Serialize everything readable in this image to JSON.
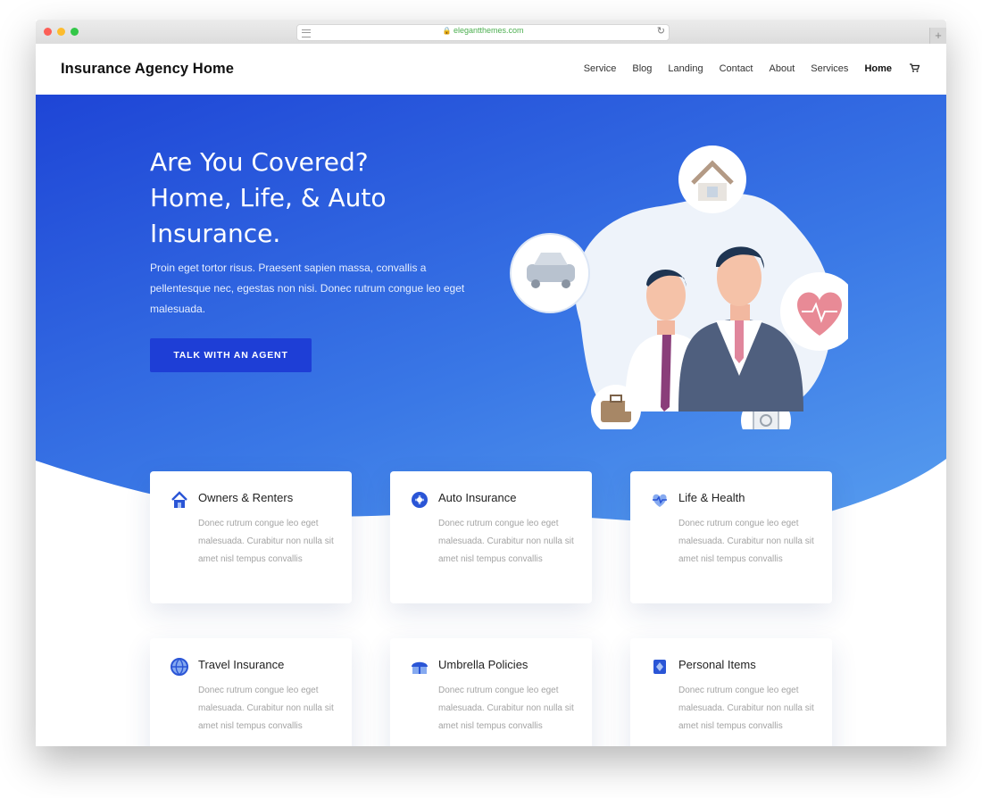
{
  "browser": {
    "url": "elegantthemes.com",
    "new_tab_label": "+"
  },
  "site": {
    "logo": "Insurance Agency Home",
    "nav": [
      "Service",
      "Blog",
      "Landing",
      "Contact",
      "About",
      "Services",
      "Home"
    ],
    "active_nav": "Home",
    "cart_icon": "cart-icon"
  },
  "hero": {
    "title_line1": "Are You Covered?",
    "title_line2": "Home, Life, & Auto",
    "title_line3": "Insurance.",
    "text": "Proin eget tortor risus. Praesent sapien massa, convallis a pellentesque nec, egestas non nisi. Donec rutrum congue leo eget malesuada.",
    "cta_label": "TALK WITH AN AGENT"
  },
  "cards": [
    {
      "title": "Owners & Renters",
      "icon": "house-icon",
      "body": "Donec rutrum congue leo eget malesuada. Curabitur non nulla sit amet nisl tempus convallis"
    },
    {
      "title": "Auto Insurance",
      "icon": "auto-icon",
      "body": "Donec rutrum congue leo eget malesuada. Curabitur non nulla sit amet nisl tempus convallis"
    },
    {
      "title": "Life & Health",
      "icon": "heart-icon",
      "body": "Donec rutrum congue leo eget malesuada. Curabitur non nulla sit amet nisl tempus convallis"
    },
    {
      "title": "Travel Insurance",
      "icon": "globe-icon",
      "body": "Donec rutrum congue leo eget malesuada. Curabitur non nulla sit amet nisl tempus convallis"
    },
    {
      "title": "Umbrella Policies",
      "icon": "umbrella-icon",
      "body": "Donec rutrum congue leo eget malesuada. Curabitur non nulla sit amet nisl tempus convallis"
    },
    {
      "title": "Personal Items",
      "icon": "jewel-icon",
      "body": "Donec rutrum congue leo eget malesuada. Curabitur non nulla sit amet nisl tempus convallis"
    }
  ],
  "colors": {
    "accent": "#1e3ed6",
    "hero_start": "#1e45d6",
    "hero_end": "#6bb7f5"
  }
}
